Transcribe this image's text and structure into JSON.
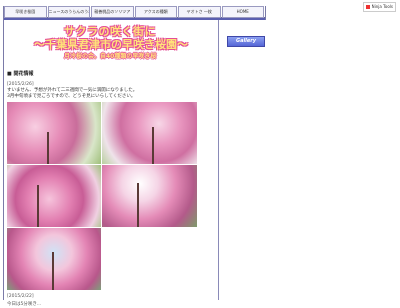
{
  "badge": {
    "label": "Ninja Tools"
  },
  "nav": [
    {
      "label": "早咲き桜園"
    },
    {
      "label": "ニュースのうらんのうわ"
    },
    {
      "label": "親善桃品のソリツア"
    },
    {
      "label": "アクスの種類"
    },
    {
      "label": "ヤオトさ  一枚"
    },
    {
      "label": "HOME"
    }
  ],
  "header": {
    "title_line1": "サクラの咲く街に",
    "title_line2": "～千葉県君津市の早咲き桜園～",
    "subtitle": "月冷桜の会。自40種類の早咲き桜"
  },
  "sidebar": {
    "gallery_label": "Gallery"
  },
  "content": {
    "section_title": "■ 開花情報",
    "entry1_date": "[2015/2/26]",
    "entry1_text1": "すいません、予想が外れて二三週間で一気に満開になりました。",
    "entry1_text2": "3月中旬頃まで見ごろですので、どうぞ見にいらしてください。",
    "entry2_date": "[2015/2/22]",
    "entry2_text": "今日は5分咲き..."
  }
}
